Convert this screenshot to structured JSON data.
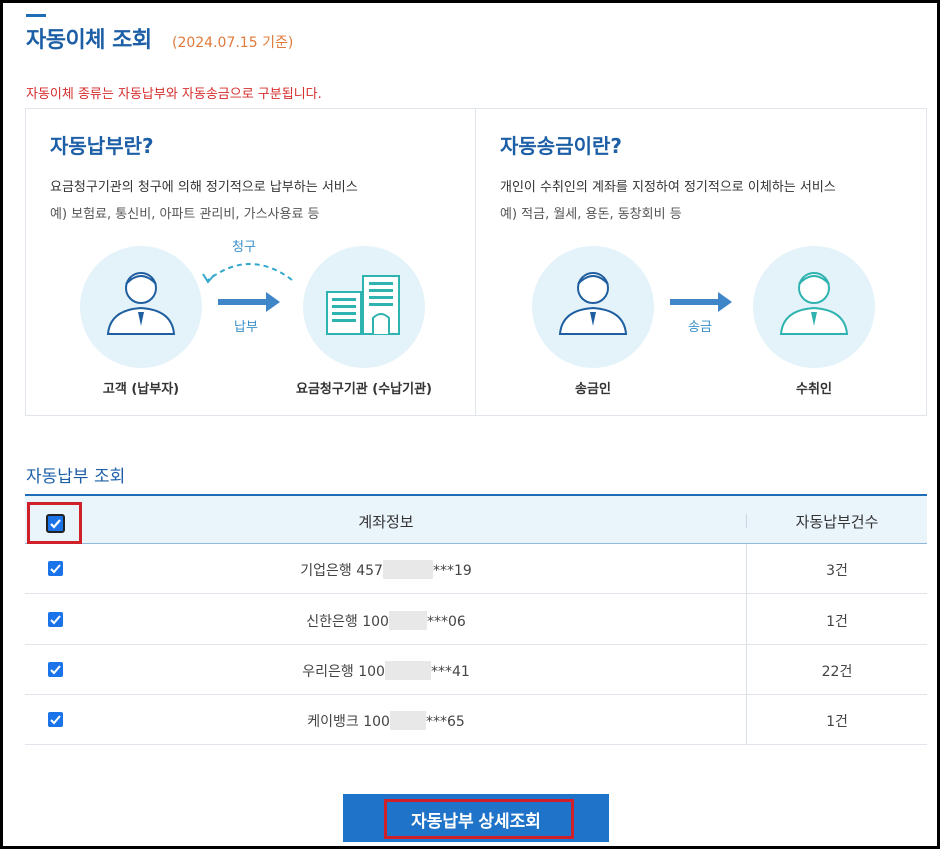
{
  "header": {
    "title": "자동이체 조회",
    "date": "(2024.07.15 기준)",
    "notice": "자동이체 종류는 자동납부와 자동송금으로 구분됩니다."
  },
  "info": {
    "auto_pay": {
      "title": "자동납부란?",
      "desc": "요금청구기관의 청구에 의해 정기적으로 납부하는 서비스",
      "example": "예) 보험료, 통신비, 아파트 관리비, 가스사용료 등",
      "left_caption": "고객 (납부자)",
      "right_caption": "요금청구기관 (수납기관)",
      "arrow_top": "청구",
      "arrow_bottom": "납부"
    },
    "auto_transfer": {
      "title": "자동송금이란?",
      "desc": "개인이 수취인의 계좌를 지정하여 정기적으로 이체하는 서비스",
      "example": "예) 적금, 월세, 용돈, 동창회비 등",
      "left_caption": "송금인",
      "right_caption": "수취인",
      "arrow_label": "송금"
    }
  },
  "table": {
    "section_title": "자동납부 조회",
    "headers": {
      "account": "계좌정보",
      "count": "자동납부건수"
    },
    "rows": [
      {
        "bank": "기업은행 457",
        "suffix": "***19",
        "count": "3건"
      },
      {
        "bank": "신한은행 100",
        "suffix": "***06",
        "count": "1건"
      },
      {
        "bank": "우리은행 100",
        "suffix": "***41",
        "count": "22건"
      },
      {
        "bank": "케이뱅크 100",
        "suffix": "***65",
        "count": "1건"
      }
    ]
  },
  "actions": {
    "detail_button": "자동납부 상세조회"
  },
  "colors": {
    "accent": "#1d5fa6",
    "button": "#1f73c8",
    "notice": "#d62d2d",
    "highlight_box": "#d0202a"
  }
}
